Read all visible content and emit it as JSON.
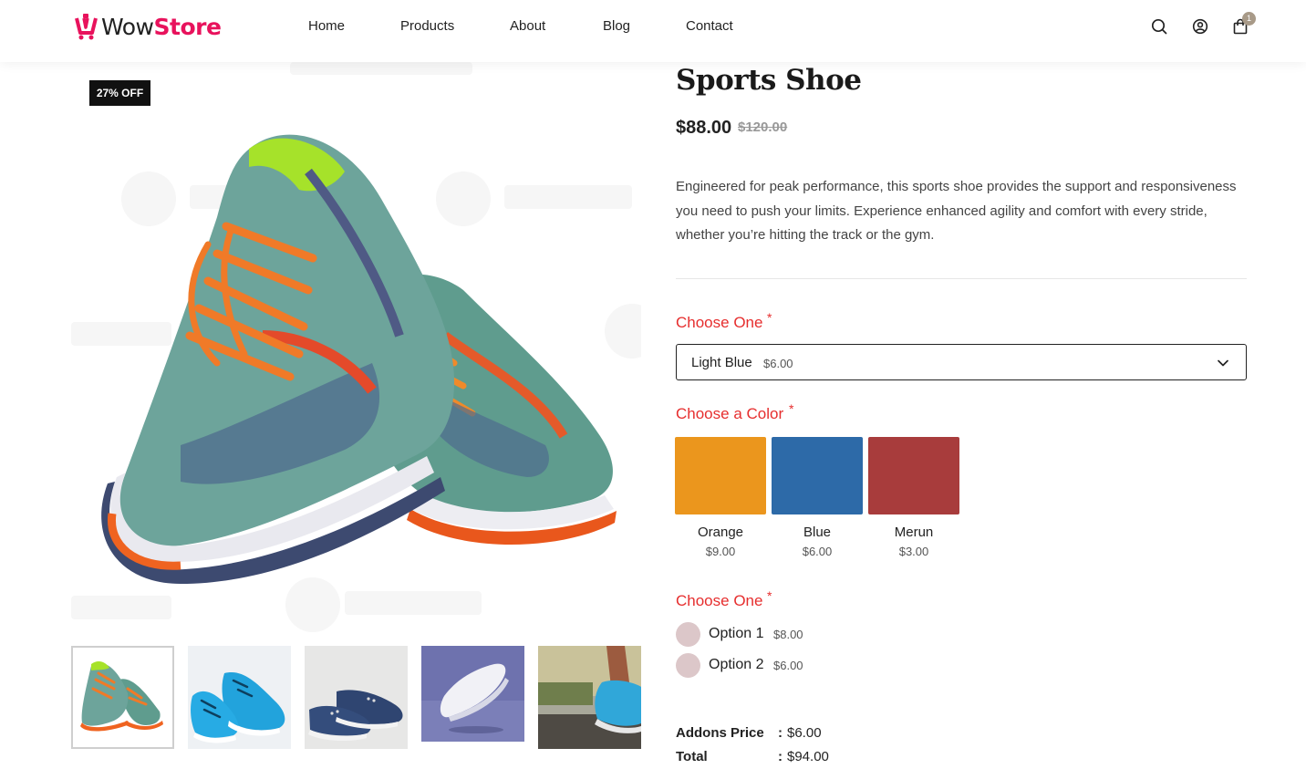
{
  "brand": {
    "name_part1": "Wow",
    "name_part2": "Store",
    "accent": "#e8125c"
  },
  "nav": [
    {
      "label": "Home"
    },
    {
      "label": "Products"
    },
    {
      "label": "About"
    },
    {
      "label": "Blog"
    },
    {
      "label": "Contact"
    }
  ],
  "header_icons": [
    "search-icon",
    "user-icon",
    "cart-icon"
  ],
  "cart": {
    "count": "1"
  },
  "gallery": {
    "badge": "27% OFF",
    "thumbnails": [
      {
        "name": "thumb-green-orange-shoe",
        "active": true
      },
      {
        "name": "thumb-blue-shoes"
      },
      {
        "name": "thumb-navy-sneakers"
      },
      {
        "name": "thumb-white-sneaker"
      },
      {
        "name": "thumb-runner-feet"
      }
    ]
  },
  "product": {
    "title": "Sports Shoe",
    "price": "$88.00",
    "old_price": "$120.00",
    "description": "Engineered for peak performance, this sports shoe provides the support and responsiveness you need to push your limits. Experience enhanced agility and comfort with every stride, whether you’re hitting the track or the gym."
  },
  "addons": {
    "select_field": {
      "label": "Choose One",
      "required_mark": "*",
      "selected_label": "Light Blue",
      "selected_price": "$6.00"
    },
    "color_field": {
      "label": "Choose a Color",
      "required_mark": "*",
      "options": [
        {
          "name": "Orange",
          "price": "$9.00",
          "color": "#eb961d"
        },
        {
          "name": "Blue",
          "price": "$6.00",
          "color": "#2d6aa8"
        },
        {
          "name": "Merun",
          "price": "$3.00",
          "color": "#a83c3c"
        }
      ]
    },
    "radio_field": {
      "label": "Choose One",
      "required_mark": "*",
      "options": [
        {
          "label": "Option 1",
          "price": "$8.00"
        },
        {
          "label": "Option 2",
          "price": "$6.00"
        }
      ]
    }
  },
  "summary": {
    "addons_label": "Addons Price",
    "addons_value": "$6.00",
    "total_label": "Total",
    "total_value": "$94.00",
    "separator": ":"
  }
}
